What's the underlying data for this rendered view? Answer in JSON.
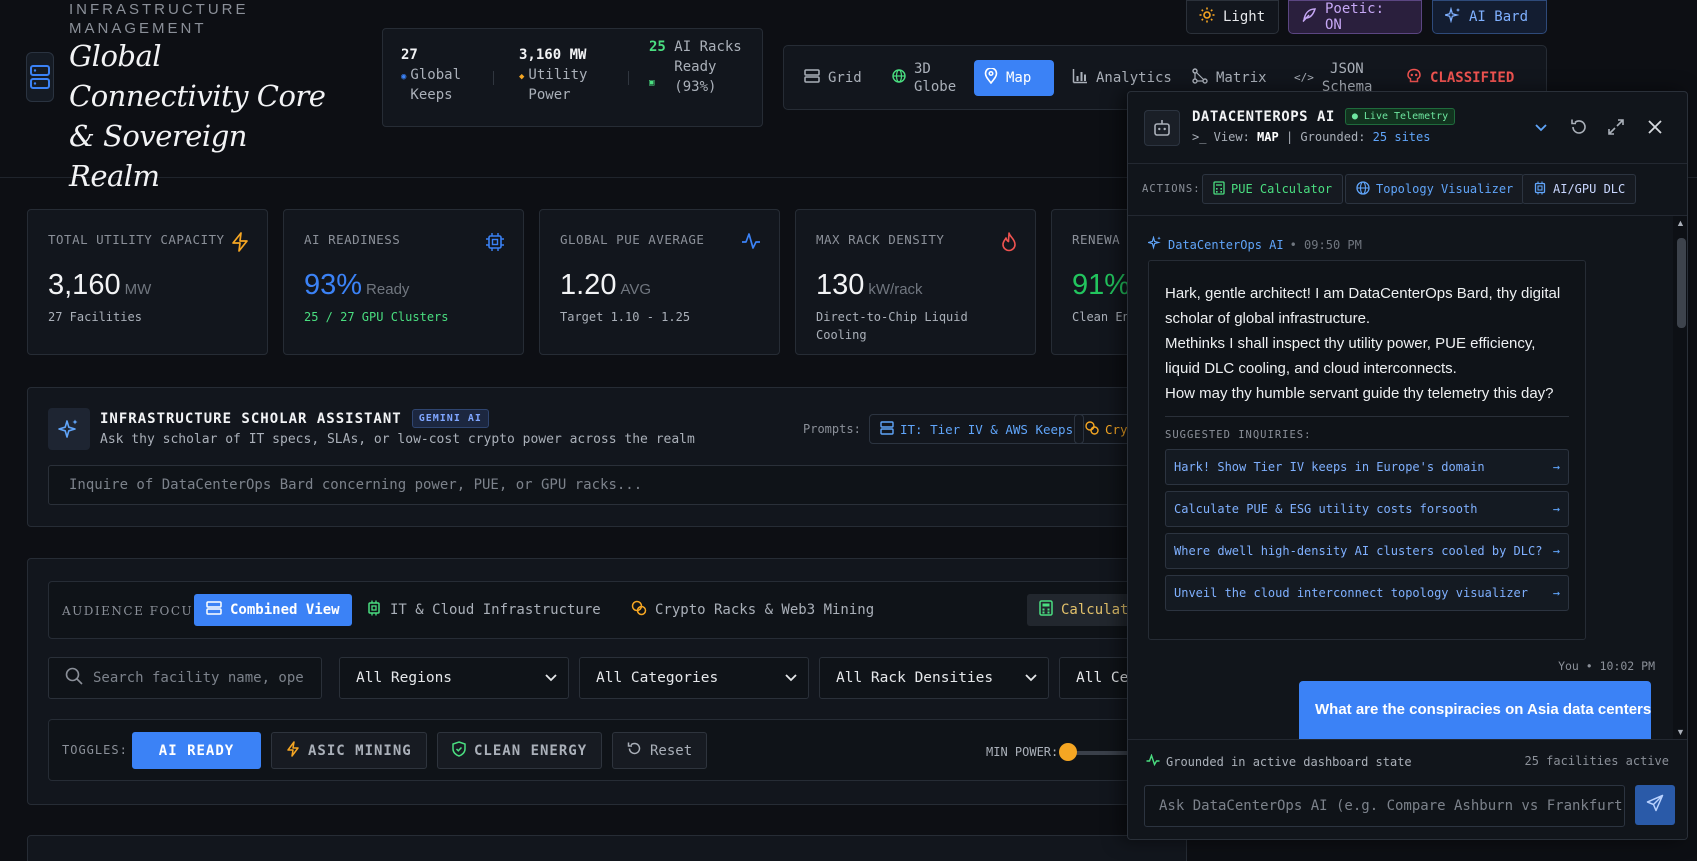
{
  "header": {
    "eyebrow": "INFRASTRUCTURE MANAGEMENT",
    "title": "Global Connectivity Core & Sovereign Realm",
    "stats": [
      {
        "value": "27",
        "label": "Global Keeps"
      },
      {
        "value": "3,160 MW",
        "label": "Utility Power"
      },
      {
        "value": "25",
        "label": "AI Racks Ready (93%)"
      }
    ],
    "buttons": {
      "light": "Light",
      "poetic": "Poetic: ON",
      "bard": "AI Bard"
    },
    "view_tabs": [
      "Grid",
      "3D Globe",
      "Map",
      "Analytics",
      "Matrix",
      "JSON Schema",
      "CLASSIFIED"
    ],
    "active_view": "Map"
  },
  "kpis": [
    {
      "label": "TOTAL UTILITY CAPACITY",
      "value": "3,160",
      "unit": "MW",
      "sub": "27 Facilities",
      "icon": "lightning-icon",
      "color": "#f5a623"
    },
    {
      "label": "AI READINESS",
      "value": "93%",
      "unit": "Ready",
      "sub": "25 / 27 GPU Clusters",
      "icon": "cpu-icon",
      "color": "#3b82f6"
    },
    {
      "label": "GLOBAL PUE AVERAGE",
      "value": "1.20",
      "unit": "AVG",
      "sub": "Target 1.10 - 1.25",
      "icon": "pulse-icon",
      "color": "#3b82f6"
    },
    {
      "label": "MAX RACK DENSITY",
      "value": "130",
      "unit": "kW/rack",
      "sub": "Direct-to-Chip Liquid Cooling",
      "icon": "flame-icon",
      "color": "#ef5350"
    },
    {
      "label": "RENEWA",
      "value": "91%",
      "unit": "",
      "sub": "Clean En",
      "icon": "leaf-icon",
      "color": "#22c55e"
    }
  ],
  "assistant": {
    "title": "INFRASTRUCTURE SCHOLAR ASSISTANT",
    "badge": "GEMINI AI",
    "subtitle": "Ask thy scholar of IT specs, SLAs, or low-cost crypto power across the realm",
    "prompts_label": "Prompts:",
    "prompts": [
      "IT: Tier IV & AWS Keeps",
      "Cryp"
    ],
    "input_placeholder": "Inquire of DataCenterOps Bard concerning power, PUE, or GPU racks..."
  },
  "filters": {
    "focus_label": "AUDIENCE FOCUS:",
    "focus_options": [
      "Combined View",
      "IT & Cloud Infrastructure",
      "Crypto Racks & Web3 Mining"
    ],
    "calc_label": "Calculat",
    "search_placeholder": "Search facility name, ope",
    "selects": [
      "All Regions",
      "All Categories",
      "All Rack Densities",
      "All Ce"
    ],
    "toggles_label": "TOGGLES:",
    "toggles": [
      "AI READY",
      "ASIC MINING",
      "CLEAN ENERGY"
    ],
    "reset_label": "Reset",
    "min_power_label": "MIN POWER:",
    "min_power_value": 0
  },
  "panel": {
    "title": "DATACENTEROPS AI",
    "live_badge": "● Live Telemetry",
    "view_prefix": ">_ View:",
    "view_value": "MAP",
    "grounded_prefix": "| Grounded:",
    "grounded_value": "25 sites",
    "actions_label": "ACTIONS:",
    "actions": [
      "PUE Calculator",
      "Topology Visualizer",
      "AI/GPU DLC"
    ],
    "bot_meta": "DataCenterOps AI",
    "bot_time": "• 09:50 PM",
    "bot_lines": [
      "Hark, gentle architect! I am DataCenterOps Bard, thy digital scholar of global infrastructure.",
      "Methinks I shall inspect thy utility power, PUE efficiency, liquid DLC cooling, and cloud interconnects.",
      "How may thy humble servant guide thy telemetry this day?"
    ],
    "suggested_label": "SUGGESTED INQUIRIES:",
    "suggestions": [
      "Hark! Show Tier IV keeps in Europe's domain",
      "Calculate PUE & ESG utility costs forsooth",
      "Where dwell high-density AI clusters cooled by DLC?",
      "Unveil the cloud interconnect topology visualizer"
    ],
    "user_meta": "You • 10:02 PM",
    "user_message": "What are the conspiracies on Asia data centers",
    "footer_grounded": "Grounded in active dashboard state",
    "footer_count": "25 facilities active",
    "input_placeholder": "Ask DataCenterOps AI (e.g. Compare Ashburn vs Frankfurt)"
  }
}
